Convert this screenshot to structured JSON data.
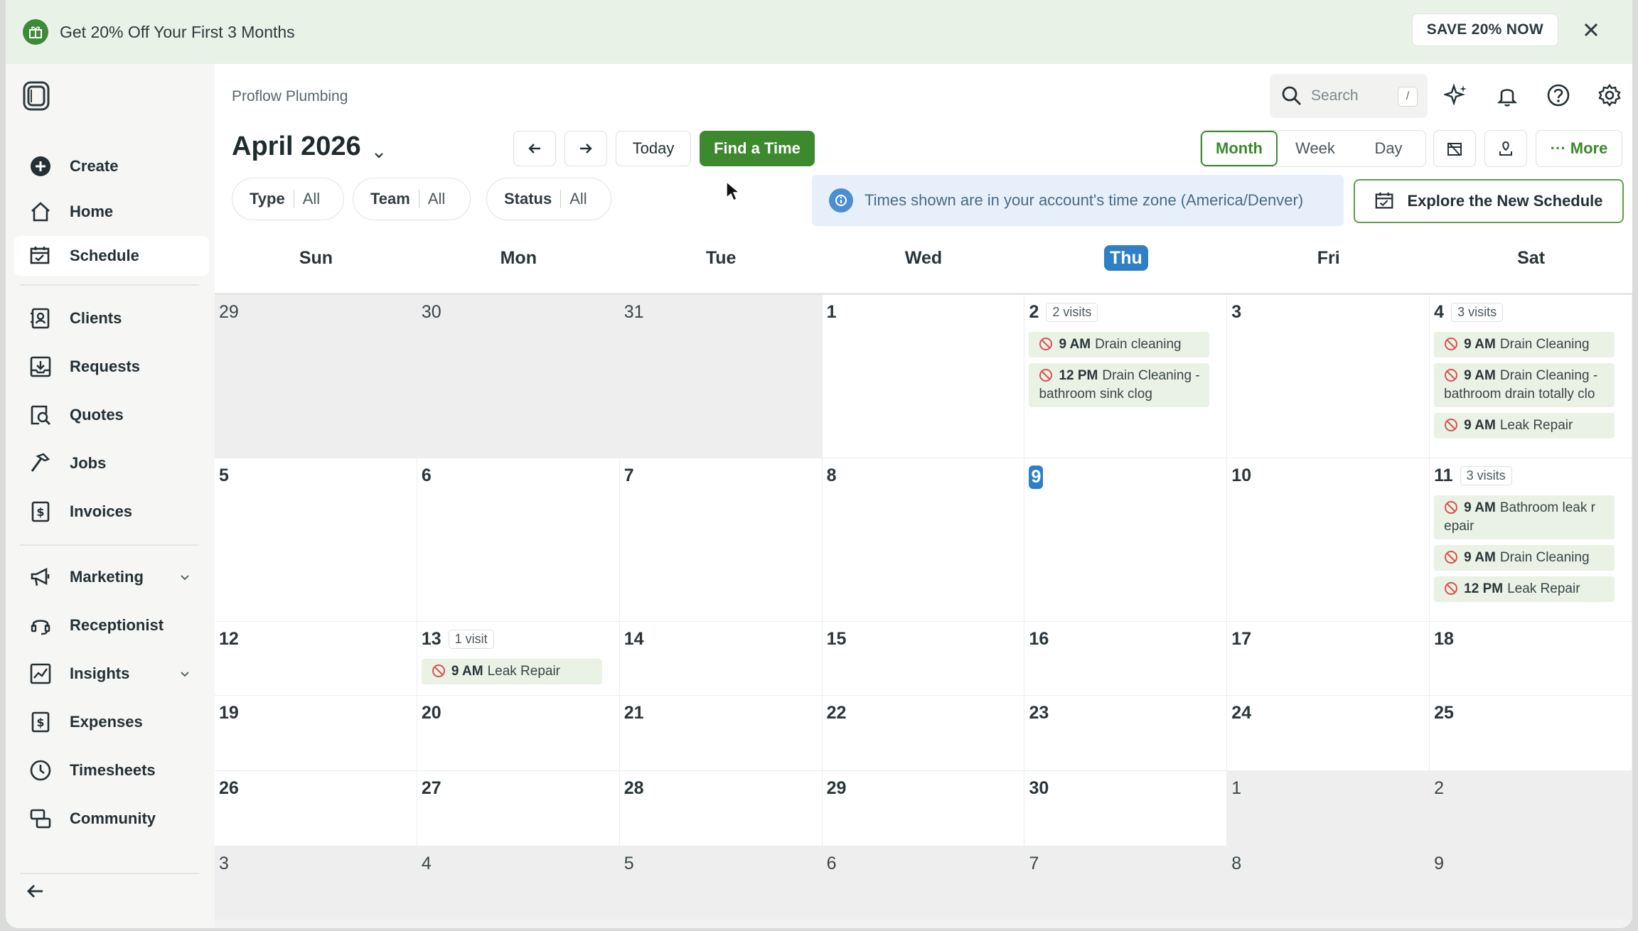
{
  "promo": {
    "text": "Get 20% Off Your First 3 Months",
    "cta": "SAVE 20% NOW"
  },
  "sidebar": {
    "items": [
      {
        "label": "Create",
        "icon": "plus-circle-icon"
      },
      {
        "label": "Home",
        "icon": "home-icon"
      },
      {
        "label": "Schedule",
        "icon": "schedule-icon",
        "active": true
      },
      {
        "label": "Clients",
        "icon": "clients-icon"
      },
      {
        "label": "Requests",
        "icon": "requests-icon"
      },
      {
        "label": "Quotes",
        "icon": "quotes-icon"
      },
      {
        "label": "Jobs",
        "icon": "hammer-icon"
      },
      {
        "label": "Invoices",
        "icon": "invoice-icon"
      },
      {
        "label": "Marketing",
        "icon": "megaphone-icon",
        "expandable": true
      },
      {
        "label": "Receptionist",
        "icon": "headset-icon"
      },
      {
        "label": "Insights",
        "icon": "insights-icon",
        "expandable": true
      },
      {
        "label": "Expenses",
        "icon": "expenses-icon"
      },
      {
        "label": "Timesheets",
        "icon": "clock-icon"
      },
      {
        "label": "Community",
        "icon": "community-icon"
      }
    ]
  },
  "header": {
    "company": "Proflow Plumbing",
    "month_title": "April 2026",
    "today_label": "Today",
    "find_time_label": "Find a Time",
    "search_placeholder": "Search",
    "search_shortcut": "/",
    "more_label": "··· More",
    "views": [
      "Month",
      "Week",
      "Day"
    ],
    "active_view": "Month"
  },
  "filters": [
    {
      "label": "Type",
      "value": "All"
    },
    {
      "label": "Team",
      "value": "All"
    },
    {
      "label": "Status",
      "value": "All"
    }
  ],
  "timezone_note": "Times shown are in your account's time zone (America/Denver)",
  "explore_label": "Explore the New Schedule",
  "weekdays": [
    "Sun",
    "Mon",
    "Tue",
    "Wed",
    "Thu",
    "Fri",
    "Sat"
  ],
  "today_weekday": "Thu",
  "weeks": [
    [
      {
        "day": "29",
        "muted": true
      },
      {
        "day": "30",
        "muted": true
      },
      {
        "day": "31",
        "muted": true
      },
      {
        "day": "1"
      },
      {
        "day": "2",
        "badge": "2 visits",
        "events": [
          {
            "time": "9 AM",
            "title": "Drain cleaning"
          },
          {
            "time": "12 PM",
            "title": "Drain Cleaning - bathroom sink clog"
          }
        ]
      },
      {
        "day": "3"
      },
      {
        "day": "4",
        "badge": "3 visits",
        "events": [
          {
            "time": "9 AM",
            "title": "Drain Cleaning"
          },
          {
            "time": "9 AM",
            "title": "Drain Cleaning - bathroom drain totally clo"
          },
          {
            "time": "9 AM",
            "title": "Leak Repair"
          }
        ]
      }
    ],
    [
      {
        "day": "5"
      },
      {
        "day": "6"
      },
      {
        "day": "7"
      },
      {
        "day": "8"
      },
      {
        "day": "9",
        "today": true
      },
      {
        "day": "10"
      },
      {
        "day": "11",
        "badge": "3 visits",
        "events": [
          {
            "time": "9 AM",
            "title": "Bathroom leak r epair"
          },
          {
            "time": "9 AM",
            "title": "Drain Cleaning"
          },
          {
            "time": "12 PM",
            "title": "Leak Repair"
          }
        ]
      }
    ],
    [
      {
        "day": "12"
      },
      {
        "day": "13",
        "badge": "1 visit",
        "events": [
          {
            "time": "9 AM",
            "title": "Leak Repair"
          }
        ]
      },
      {
        "day": "14"
      },
      {
        "day": "15"
      },
      {
        "day": "16"
      },
      {
        "day": "17"
      },
      {
        "day": "18"
      }
    ],
    [
      {
        "day": "19"
      },
      {
        "day": "20"
      },
      {
        "day": "21"
      },
      {
        "day": "22"
      },
      {
        "day": "23"
      },
      {
        "day": "24"
      },
      {
        "day": "25"
      }
    ],
    [
      {
        "day": "26"
      },
      {
        "day": "27"
      },
      {
        "day": "28"
      },
      {
        "day": "29"
      },
      {
        "day": "30"
      },
      {
        "day": "1",
        "muted": true
      },
      {
        "day": "2",
        "muted": true
      }
    ],
    [
      {
        "day": "3",
        "muted": true
      },
      {
        "day": "4",
        "muted": true
      },
      {
        "day": "5",
        "muted": true
      },
      {
        "day": "6",
        "muted": true
      },
      {
        "day": "7",
        "muted": true
      },
      {
        "day": "8",
        "muted": true
      },
      {
        "day": "9",
        "muted": true
      }
    ]
  ],
  "colors": {
    "brand_green": "#3c8a2d",
    "today_blue": "#2f7fc7",
    "event_bg": "#e9f2e5",
    "muted_cell": "#eeeeee"
  }
}
